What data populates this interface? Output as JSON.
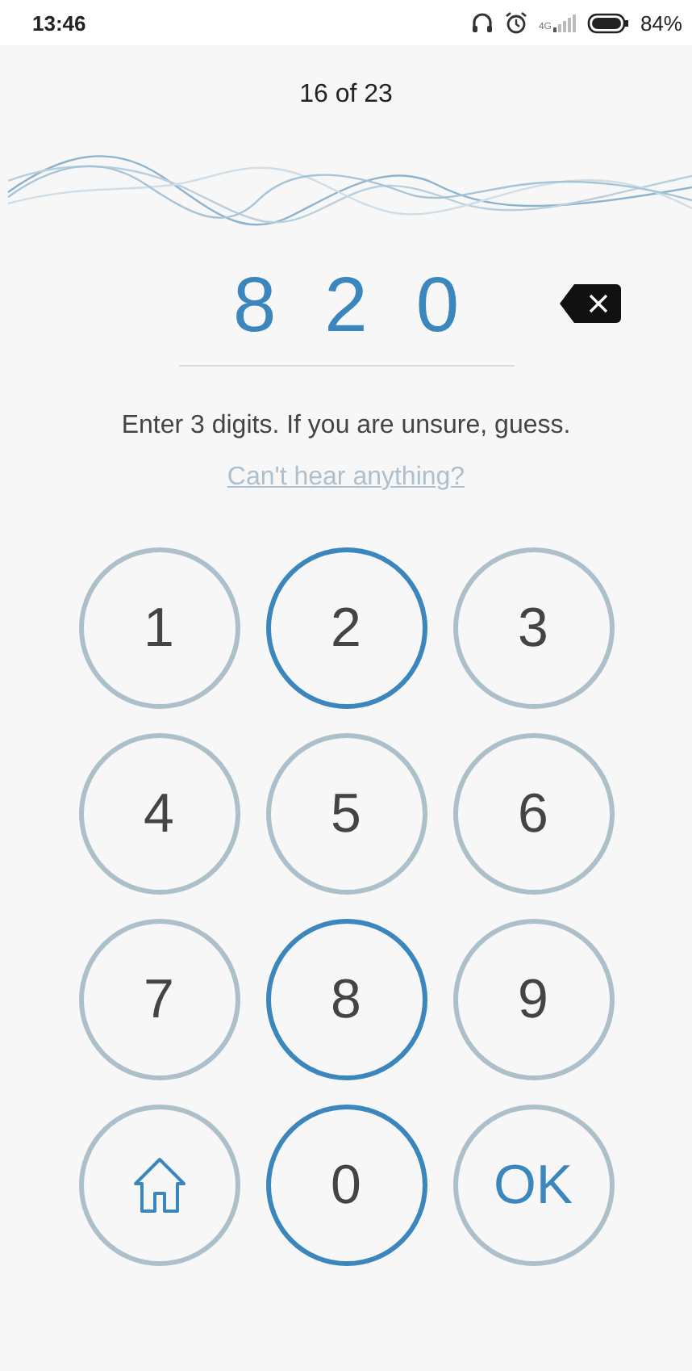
{
  "status_bar": {
    "time": "13:46",
    "network": "4G",
    "battery": "84%"
  },
  "progress": "16 of 23",
  "entry": {
    "digits": [
      "8",
      "2",
      "0"
    ]
  },
  "instruction": "Enter 3 digits. If you are unsure, guess.",
  "help_link": "Can't hear anything?",
  "keypad": [
    {
      "kind": "digit",
      "label": "1",
      "highlighted": false
    },
    {
      "kind": "digit",
      "label": "2",
      "highlighted": true
    },
    {
      "kind": "digit",
      "label": "3",
      "highlighted": false
    },
    {
      "kind": "digit",
      "label": "4",
      "highlighted": false
    },
    {
      "kind": "digit",
      "label": "5",
      "highlighted": false
    },
    {
      "kind": "digit",
      "label": "6",
      "highlighted": false
    },
    {
      "kind": "digit",
      "label": "7",
      "highlighted": false
    },
    {
      "kind": "digit",
      "label": "8",
      "highlighted": true
    },
    {
      "kind": "digit",
      "label": "9",
      "highlighted": false
    },
    {
      "kind": "home",
      "highlighted": false
    },
    {
      "kind": "digit",
      "label": "0",
      "highlighted": true
    },
    {
      "kind": "ok",
      "label": "OK",
      "highlighted": false
    }
  ]
}
